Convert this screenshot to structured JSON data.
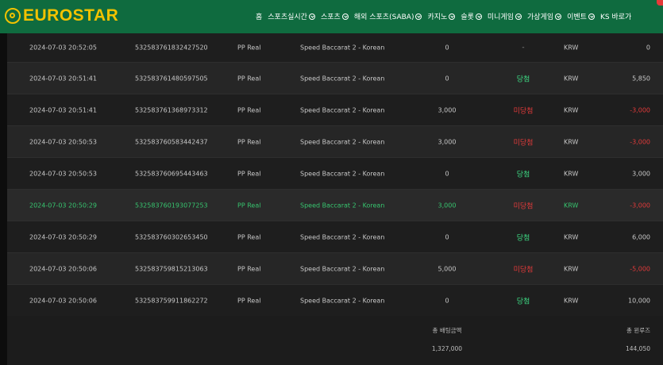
{
  "brand": {
    "logo_text": "EUROSTAR",
    "primary_color": "#0f6b3f",
    "logo_color": "#f2c200"
  },
  "nav": {
    "items": [
      {
        "label": "홈",
        "dropdown": false
      },
      {
        "label": "스포츠실시간",
        "dropdown": true
      },
      {
        "label": "스포츠",
        "dropdown": true
      },
      {
        "label": "해외 스포츠(SABA)",
        "dropdown": true
      },
      {
        "label": "카지노",
        "dropdown": true
      },
      {
        "label": "슬롯",
        "dropdown": true
      },
      {
        "label": "미니게임",
        "dropdown": true
      },
      {
        "label": "가상게임",
        "dropdown": true
      },
      {
        "label": "이벤트",
        "dropdown": true
      },
      {
        "label": "KS 바로가",
        "dropdown": false
      }
    ]
  },
  "bets": {
    "rows": [
      {
        "date": "2024-07-03 20:52:05",
        "id": "532583761832427520",
        "provider": "PP Real",
        "game": "Speed Baccarat 2 - Korean",
        "bet": "0",
        "result": "-",
        "result_type": "none",
        "currency": "KRW",
        "win": "0",
        "negative": false,
        "highlight": false
      },
      {
        "date": "2024-07-03 20:51:41",
        "id": "532583761480597505",
        "provider": "PP Real",
        "game": "Speed Baccarat 2 - Korean",
        "bet": "0",
        "result": "당첨",
        "result_type": "win",
        "currency": "KRW",
        "win": "5,850",
        "negative": false,
        "highlight": false
      },
      {
        "date": "2024-07-03 20:51:41",
        "id": "532583761368973312",
        "provider": "PP Real",
        "game": "Speed Baccarat 2 - Korean",
        "bet": "3,000",
        "result": "미당첨",
        "result_type": "lose",
        "currency": "KRW",
        "win": "-3,000",
        "negative": true,
        "highlight": false
      },
      {
        "date": "2024-07-03 20:50:53",
        "id": "532583760583442437",
        "provider": "PP Real",
        "game": "Speed Baccarat 2 - Korean",
        "bet": "3,000",
        "result": "미당첨",
        "result_type": "lose",
        "currency": "KRW",
        "win": "-3,000",
        "negative": true,
        "highlight": false
      },
      {
        "date": "2024-07-03 20:50:53",
        "id": "532583760695443463",
        "provider": "PP Real",
        "game": "Speed Baccarat 2 - Korean",
        "bet": "0",
        "result": "당첨",
        "result_type": "win",
        "currency": "KRW",
        "win": "3,000",
        "negative": false,
        "highlight": false
      },
      {
        "date": "2024-07-03 20:50:29",
        "id": "532583760193077253",
        "provider": "PP Real",
        "game": "Speed Baccarat 2 - Korean",
        "bet": "3,000",
        "result": "미당첨",
        "result_type": "lose",
        "currency": "KRW",
        "win": "-3,000",
        "negative": true,
        "highlight": true
      },
      {
        "date": "2024-07-03 20:50:29",
        "id": "532583760302653450",
        "provider": "PP Real",
        "game": "Speed Baccarat 2 - Korean",
        "bet": "0",
        "result": "당첨",
        "result_type": "win",
        "currency": "KRW",
        "win": "6,000",
        "negative": false,
        "highlight": false
      },
      {
        "date": "2024-07-03 20:50:06",
        "id": "532583759815213063",
        "provider": "PP Real",
        "game": "Speed Baccarat 2 - Korean",
        "bet": "5,000",
        "result": "미당첨",
        "result_type": "lose",
        "currency": "KRW",
        "win": "-5,000",
        "negative": true,
        "highlight": false
      },
      {
        "date": "2024-07-03 20:50:06",
        "id": "532583759911862272",
        "provider": "PP Real",
        "game": "Speed Baccarat 2 - Korean",
        "bet": "0",
        "result": "당첨",
        "result_type": "win",
        "currency": "KRW",
        "win": "10,000",
        "negative": false,
        "highlight": false
      }
    ],
    "totals": {
      "bet_label": "총 배팅금액",
      "bet_value": "1,327,000",
      "win_label": "총 윈루즈",
      "win_value": "144,050"
    }
  }
}
